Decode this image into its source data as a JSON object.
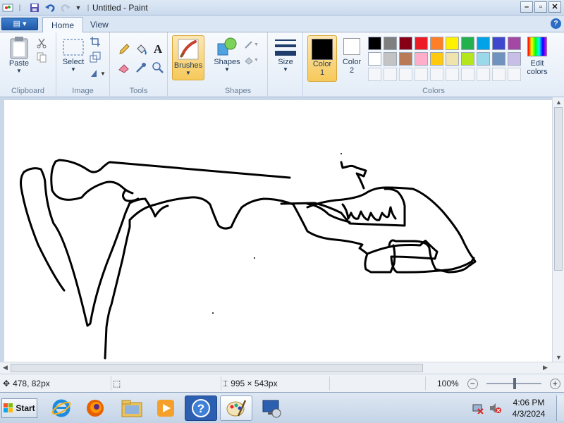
{
  "window": {
    "title": "Untitled - Paint"
  },
  "tabs": {
    "file_label": "",
    "home": "Home",
    "view": "View"
  },
  "ribbon": {
    "clipboard": {
      "paste": "Paste",
      "label": "Clipboard"
    },
    "image": {
      "select": "Select",
      "label": "Image"
    },
    "tools": {
      "label": "Tools",
      "text_glyph": "A"
    },
    "brushes": "Brushes",
    "shapes": {
      "shapes": "Shapes",
      "label": "Shapes"
    },
    "size": "Size",
    "color1": {
      "line1": "Color",
      "line2": "1"
    },
    "color2": {
      "line1": "Color",
      "line2": "2"
    },
    "edit_colors": {
      "line1": "Edit",
      "line2": "colors"
    },
    "colors_label": "Colors",
    "palette_row1": [
      "#000000",
      "#7f7f7f",
      "#880015",
      "#ed1c24",
      "#ff7f27",
      "#fff200",
      "#22b14c",
      "#00a2e8",
      "#3f48cc",
      "#a349a4"
    ],
    "palette_row2": [
      "#ffffff",
      "#c3c3c3",
      "#b97a57",
      "#ffaec9",
      "#ffc90e",
      "#efe4b0",
      "#b5e61d",
      "#99d9ea",
      "#7092be",
      "#c8bfe7"
    ]
  },
  "status": {
    "cursor_pos": "478, 82px",
    "selection_size": "",
    "canvas_size": "995 × 543px",
    "zoom": "100%"
  },
  "taskbar": {
    "start": "Start",
    "time": "4:06 PM",
    "date": "4/3/2024"
  }
}
